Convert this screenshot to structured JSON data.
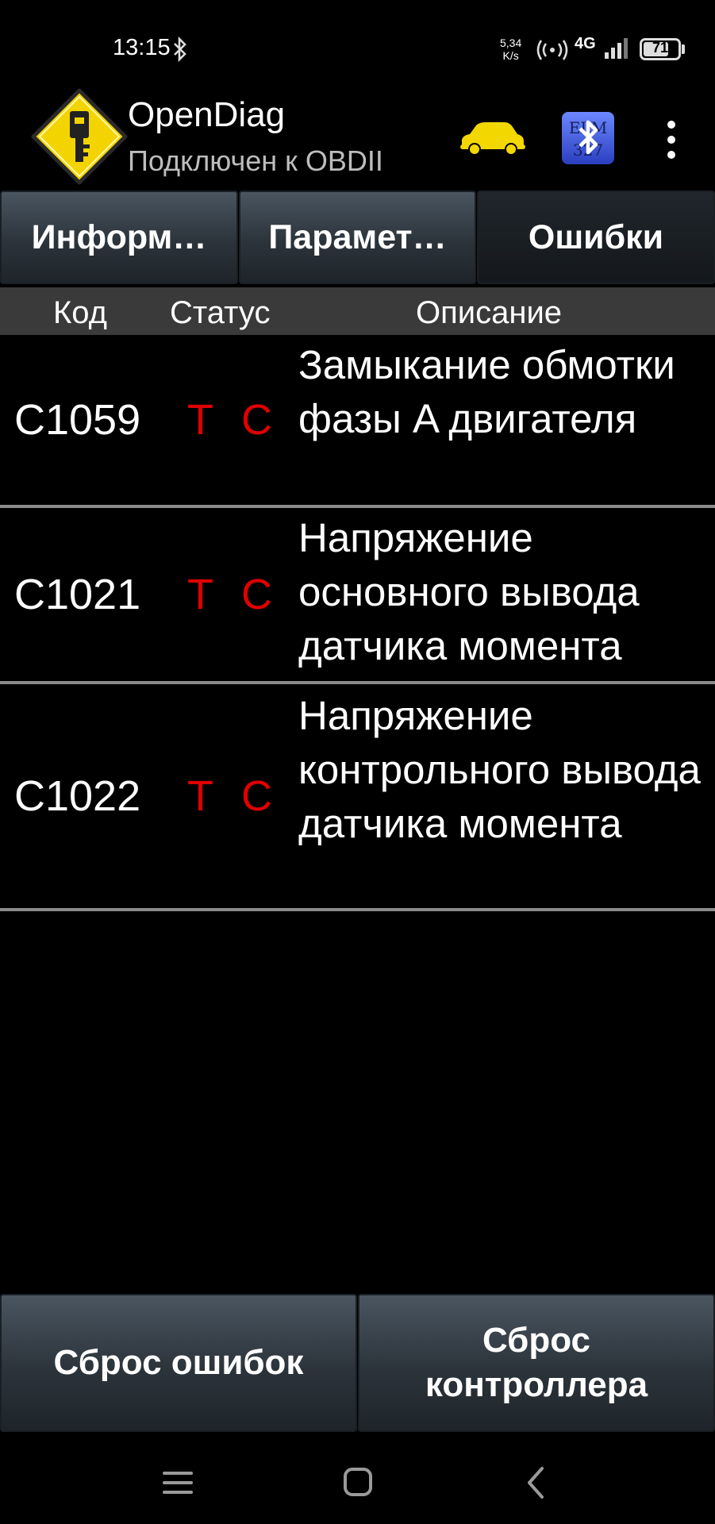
{
  "status_bar": {
    "time": "13:15",
    "net_speed_value": "5,34",
    "net_speed_unit": "K/s",
    "network": "4G",
    "battery": "71"
  },
  "app_bar": {
    "title": "OpenDiag",
    "subtitle": "Подключен к OBDII",
    "icons": [
      "opendiag-logo-icon",
      "car-icon",
      "elm327-bluetooth-icon",
      "more-vert-icon"
    ]
  },
  "tabs": [
    {
      "label": "Информ…",
      "active": false
    },
    {
      "label": "Парамет…",
      "active": false
    },
    {
      "label": "Ошибки",
      "active": true
    }
  ],
  "table": {
    "headers": {
      "code": "Код",
      "status": "Статус",
      "description": "Описание"
    },
    "rows": [
      {
        "code": "C1059",
        "status_t": "T",
        "status_c": "C",
        "description": "Замыкание обмотки фазы A двигателя"
      },
      {
        "code": "C1021",
        "status_t": "T",
        "status_c": "C",
        "description": "Напряжение основного вывода датчика момента"
      },
      {
        "code": "C1022",
        "status_t": "T",
        "status_c": "C",
        "description": "Напряжение контрольного вывода датчика момента"
      }
    ]
  },
  "buttons": {
    "reset_errors": "Сброс ошибок",
    "reset_controller": "Сброс контроллера"
  },
  "colors": {
    "status_red": "#e00000",
    "car_yellow": "#f3d700",
    "elm_blue": "#3a55d8"
  }
}
